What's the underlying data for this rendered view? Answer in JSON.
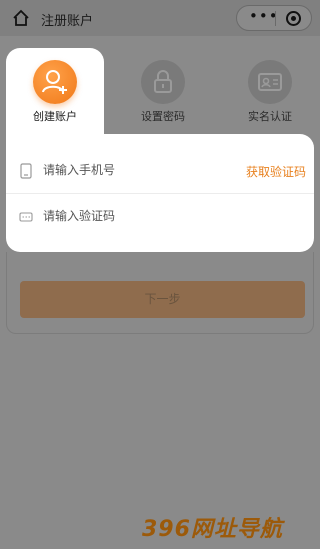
{
  "nav": {
    "title": "注册账户",
    "home_icon": "home-icon",
    "more_icon": "more-dots-icon",
    "close_icon": "target-icon"
  },
  "steps": [
    {
      "label": "创建账户",
      "icon": "user-add-icon",
      "active": true
    },
    {
      "label": "设置密码",
      "icon": "lock-icon",
      "active": false
    },
    {
      "label": "实名认证",
      "icon": "id-card-icon",
      "active": false
    }
  ],
  "form": {
    "phone_placeholder": "请输入手机号",
    "code_placeholder": "请输入验证码",
    "get_code_label": "获取验证码"
  },
  "next_label": "下一步",
  "watermark": "396网址导航",
  "colors": {
    "accent": "#f07818",
    "link": "#e8811f"
  }
}
